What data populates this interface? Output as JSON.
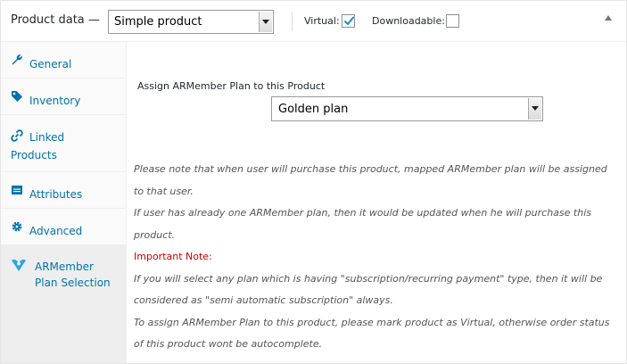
{
  "header": {
    "title": "Product data —",
    "product_type": "Simple product",
    "virtual_label": "Virtual:",
    "virtual_checked": true,
    "downloadable_label": "Downloadable:",
    "downloadable_checked": false,
    "toggle_icon": "triangle-up-icon"
  },
  "tabs": [
    {
      "label": "General",
      "icon": "wrench-icon"
    },
    {
      "label": "Inventory",
      "icon": "tag-icon"
    },
    {
      "label": "Linked",
      "label2": "Products",
      "icon": "link-icon"
    },
    {
      "label": "Attributes",
      "icon": "list-icon"
    },
    {
      "label": "Advanced",
      "icon": "gear-icon"
    },
    {
      "label": "ARMember",
      "label2": "Plan Selection",
      "icon": "armember-icon",
      "active": true
    }
  ],
  "panel": {
    "assign_label": "Assign ARMember Plan to this Product",
    "selected_plan": "Golden plan",
    "note_lines": [
      "Please note that when user will purchase this product, mapped ARMember plan will be assigned",
      "to that user.",
      "If user has already one ARMember plan, then it would be updated when he will purchase this",
      "product."
    ],
    "important_label": "Important Note:",
    "important_lines": [
      "If you will select any plan which is having \"subscription/recurring payment\" type, then it will be",
      "considered as \"semi automatic subscription\" always.",
      "To assign ARMember Plan to this product, please mark product as Virtual, otherwise order status",
      "of this product wont be autocomplete."
    ]
  },
  "colors": {
    "link": "#0073aa",
    "checkbox_check": "#1e8cbe",
    "important": "#cc0000",
    "note_text": "#555555"
  }
}
